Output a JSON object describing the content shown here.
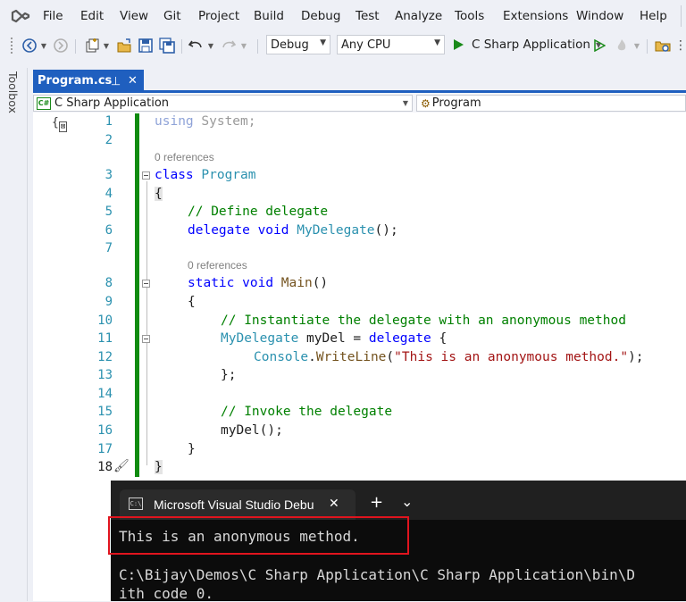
{
  "menu": {
    "items": [
      "File",
      "Edit",
      "View",
      "Git",
      "Project",
      "Build",
      "Debug",
      "Test",
      "Analyze",
      "Tools",
      "Extensions",
      "Window",
      "Help"
    ]
  },
  "toolbar": {
    "config": "Debug",
    "platform": "Any CPU",
    "start_label": "C Sharp Application"
  },
  "side": {
    "toolbox_label": "Toolbox"
  },
  "tab": {
    "title": "Program.cs",
    "pin_glyph": "⊣",
    "close_glyph": "✕"
  },
  "nav": {
    "project": "C Sharp Application",
    "class": "Program"
  },
  "editor": {
    "line_numbers": [
      "1",
      "2",
      "3",
      "4",
      "5",
      "6",
      "7",
      "8",
      "9",
      "10",
      "11",
      "12",
      "13",
      "14",
      "15",
      "16",
      "17",
      "18"
    ],
    "references_1": "0 references",
    "references_2": "0 references",
    "code": {
      "l1_kw": "using",
      "l1_rest": " System;",
      "l3_kw": "class",
      "l3_type": "Program",
      "l4": "{",
      "l5": "// Define delegate",
      "l6_kw1": "delegate",
      "l6_kw2": "void",
      "l6_type": "MyDelegate",
      "l6_rest": "();",
      "l8_kw1": "static",
      "l8_kw2": "void",
      "l8_name": "Main",
      "l8_rest": "()",
      "l9": "{",
      "l10": "// Instantiate the delegate with an anonymous method",
      "l11_type": "MyDelegate",
      "l11_mid": " myDel = ",
      "l11_kw": "delegate",
      "l11_rest": " {",
      "l12_type": "Console",
      "l12_dot": ".",
      "l12_method": "WriteLine",
      "l12_open": "(",
      "l12_str": "\"This is an anonymous method.\"",
      "l12_close": ");",
      "l13": "};",
      "l15": "// Invoke the delegate",
      "l16_name": "myDel",
      "l16_rest": "();",
      "l17": "}",
      "l18": "}"
    }
  },
  "console": {
    "tab_title": "Microsoft Visual Studio Debu",
    "close_glyph": "✕",
    "add_glyph": "+",
    "menu_glyph": "⌄",
    "output_line": "This is an anonymous method.",
    "path_line": "C:\\Bijay\\Demos\\C Sharp Application\\C Sharp Application\\bin\\D",
    "exit_line": "ith code 0."
  }
}
